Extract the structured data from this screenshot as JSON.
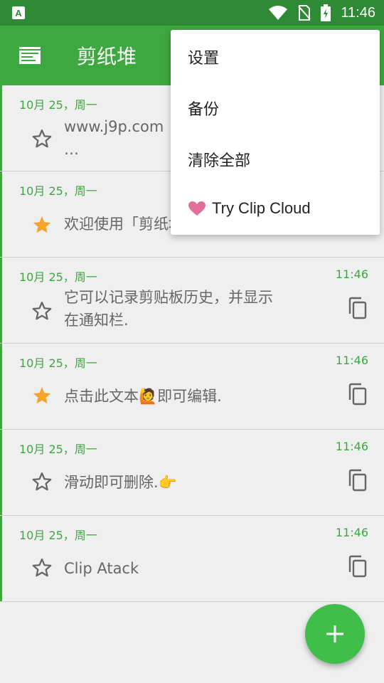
{
  "status": {
    "time": "11:46",
    "icons": [
      "wifi-icon",
      "no-sim-icon",
      "battery-charging-icon"
    ],
    "left_icon": "a-notification-icon"
  },
  "app": {
    "title": "剪纸堆",
    "icon": "clip-stack-icon",
    "accent": "#3da83f"
  },
  "menu": {
    "items": [
      {
        "label": "设置"
      },
      {
        "label": "备份"
      },
      {
        "label": "清除全部"
      },
      {
        "label": "Try Clip Cloud",
        "icon": "heart-icon"
      }
    ]
  },
  "clips": [
    {
      "date": "10月 25，周一",
      "time": "",
      "starred": false,
      "text_line1": "www.j9p.com",
      "text_line2": "…"
    },
    {
      "date": "10月 25，周一",
      "time": "",
      "starred": true,
      "text_line1": "欢迎使用「剪纸堆」",
      "text_line2": ""
    },
    {
      "date": "10月 25，周一",
      "time": "11:46",
      "starred": false,
      "text_line1": "它可以记录剪贴板历史，并显示",
      "text_line2": "在通知栏."
    },
    {
      "date": "10月 25，周一",
      "time": "11:46",
      "starred": true,
      "text_line1": "点击此文本🙋即可编辑.",
      "text_line2": ""
    },
    {
      "date": "10月 25，周一",
      "time": "11:46",
      "starred": false,
      "text_line1": "滑动即可删除.👉",
      "text_line2": ""
    },
    {
      "date": "10月 25，周一",
      "time": "11:46",
      "starred": false,
      "text_line1": "Clip Atack",
      "text_line2": ""
    }
  ],
  "fab": {
    "icon": "plus-icon"
  }
}
